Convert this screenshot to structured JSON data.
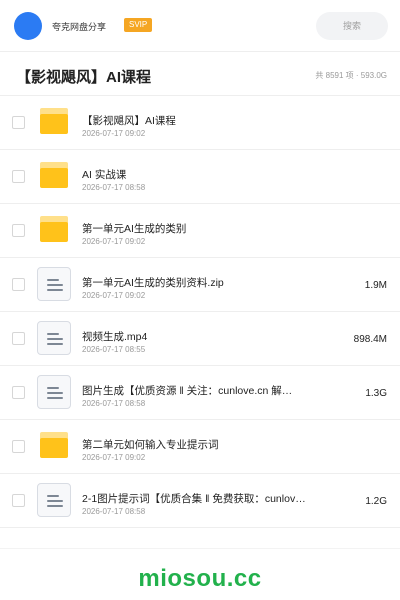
{
  "header": {
    "app_name": "夸克网盘分享",
    "vip_label": "SVIP",
    "search_placeholder": "搜索"
  },
  "folder": {
    "title": "【影视飓风】AI课程",
    "summary": "共 8591 项 · 593.0G"
  },
  "files": [
    {
      "type": "folder",
      "name": "【影视飓风】AI课程",
      "date": "2026-07-17 09:02",
      "size": ""
    },
    {
      "type": "folder",
      "name": "AI 实战课",
      "date": "2026-07-17 08:58",
      "size": ""
    },
    {
      "type": "folder",
      "name": "第一单元AI生成的类别",
      "date": "2026-07-17 09:02",
      "size": ""
    },
    {
      "type": "file",
      "name": "第一单元AI生成的类别资料.zip",
      "date": "2026-07-17 09:02",
      "size": "1.9M"
    },
    {
      "type": "file",
      "name": "视频生成.mp4",
      "date": "2026-07-17 08:55",
      "size": "898.4M"
    },
    {
      "type": "file",
      "name": "图片生成【优质资源 ‖ 关注：cunlove.cn 解…",
      "date": "2026-07-17 08:58",
      "size": "1.3G"
    },
    {
      "type": "folder",
      "name": "第二单元如何输入专业提示词",
      "date": "2026-07-17 09:02",
      "size": ""
    },
    {
      "type": "file",
      "name": "2-1图片提示词【优质合集 ‖ 免费获取：cunlov…",
      "date": "2026-07-17 08:58",
      "size": "1.2G"
    }
  ],
  "footer": {
    "brand": "miosou.cc"
  },
  "colors": {
    "avatar": "#2b7bf3",
    "vip_badge": "#f5a623",
    "folder": "#ffc21a",
    "brand": "#22b14c"
  }
}
